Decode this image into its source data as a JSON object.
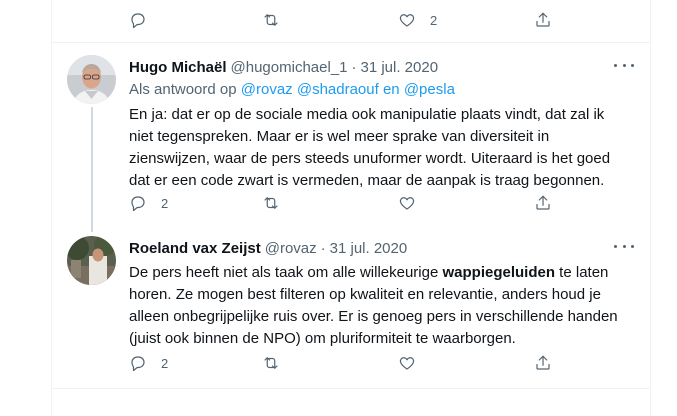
{
  "prev_tweet": {
    "likes": "2"
  },
  "tweets": [
    {
      "name": "Hugo Michaël",
      "handle": "@hugomichael_1",
      "dot": "·",
      "date": "31 jul. 2020",
      "reply_prefix": "Als antwoord op",
      "reply_mentions": [
        "@rovaz",
        "@shadraouf",
        "en",
        "@pesla"
      ],
      "lines": [
        "En ja: dat er op de sociale media ook manipulatie plaats vindt, dat zal ik",
        "niet tegenspreken. Maar er is wel meer sprake van diversiteit in",
        "zienswijzen, waar de pers steeds unuformer wordt. Uiteraard is het goed",
        "dat er een code zwart is vermeden, maar de aanpak is traag begonnen."
      ],
      "replies": "2"
    },
    {
      "name": "Roeland vax Zeijst",
      "handle": "@rovaz",
      "dot": "·",
      "date": "31 jul. 2020",
      "line1_pre": "De pers heeft niet als taak om alle willekeurige ",
      "line1_bold": "wappiegeluiden",
      "line1_post": " te laten",
      "lines": [
        "horen. Ze mogen best filteren op kwaliteit en relevantie, anders houd je",
        "alleen onbegrijpelijke ruis over. Er is genoeg pers in verschillende handen",
        "(juist ook binnen de NPO) om pluriformiteit te waarborgen."
      ],
      "replies": "2"
    }
  ],
  "icons": [
    "reply-icon",
    "retweet-icon",
    "like-icon",
    "share-icon",
    "more-icon"
  ],
  "colors": {
    "link": "#1d9bf0",
    "secondary": "#536471",
    "border": "#eff3f4",
    "thread": "#cfd9de"
  }
}
